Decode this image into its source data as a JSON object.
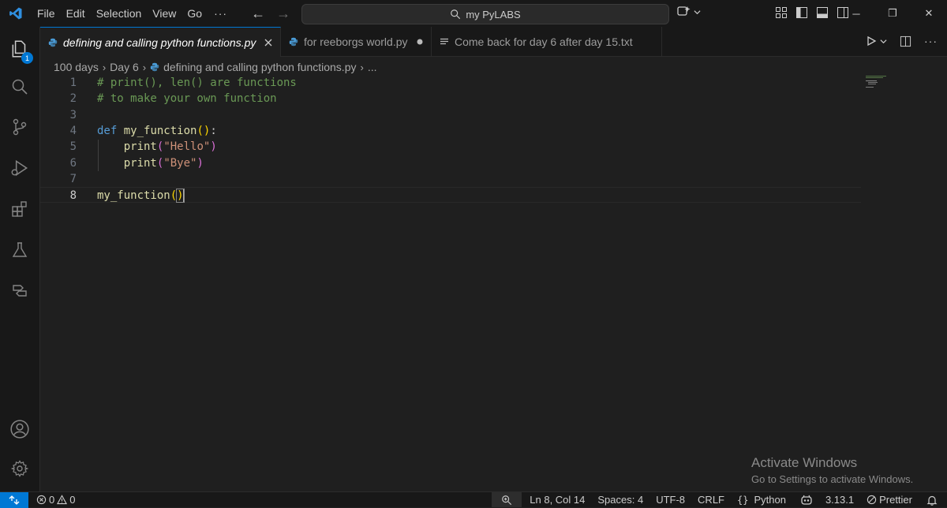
{
  "titlebar": {
    "menus": [
      "File",
      "Edit",
      "Selection",
      "View",
      "Go"
    ],
    "more": "···",
    "search_text": "my PyLABS"
  },
  "activity": {
    "icons": [
      "explorer-icon",
      "search-icon",
      "source-control-icon",
      "run-debug-icon",
      "extensions-icon",
      "testing-icon",
      "remote-explorer-icon",
      "account-icon",
      "manage-gear-icon"
    ],
    "explorer_badge": "1"
  },
  "tabs": [
    {
      "label": "defining and calling python functions.py",
      "icon": "python-icon",
      "active": true,
      "state": "close"
    },
    {
      "label": "for reeborgs world.py",
      "icon": "python-icon",
      "active": false,
      "state": "dirty"
    },
    {
      "label": "Come back for day 6 after day 15.txt",
      "icon": "text-file-icon",
      "active": false,
      "state": "none"
    }
  ],
  "breadcrumb": {
    "items": [
      "100 days",
      "Day 6",
      "defining and calling python functions.py"
    ],
    "ellipsis": "..."
  },
  "editor": {
    "current_line": 8,
    "lines": [
      {
        "n": "1",
        "tokens": [
          [
            "# print(), len() are functions",
            "comment"
          ]
        ]
      },
      {
        "n": "2",
        "tokens": [
          [
            "# to make your own function",
            "comment"
          ]
        ]
      },
      {
        "n": "3",
        "tokens": []
      },
      {
        "n": "4",
        "tokens": [
          [
            "def",
            "kw"
          ],
          [
            " ",
            "text"
          ],
          [
            "my_function",
            "fn"
          ],
          [
            "()",
            "p1"
          ],
          [
            ":",
            "text"
          ]
        ]
      },
      {
        "n": "5",
        "tokens": [
          [
            "    ",
            "text"
          ],
          [
            "print",
            "fn"
          ],
          [
            "(",
            "p2"
          ],
          [
            "\"Hello\"",
            "str"
          ],
          [
            ")",
            "p2"
          ]
        ]
      },
      {
        "n": "6",
        "tokens": [
          [
            "    ",
            "text"
          ],
          [
            "print",
            "fn"
          ],
          [
            "(",
            "p2"
          ],
          [
            "\"Bye\"",
            "str"
          ],
          [
            ")",
            "p2"
          ]
        ]
      },
      {
        "n": "7",
        "tokens": []
      },
      {
        "n": "8",
        "tokens": [
          [
            "my_function",
            "fn"
          ],
          [
            "(",
            "p1"
          ],
          [
            ")",
            "p1-cursor"
          ]
        ]
      }
    ]
  },
  "watermark": {
    "title": "Activate Windows",
    "subtitle": "Go to Settings to activate Windows."
  },
  "statusbar": {
    "errors": "0",
    "warnings": "0",
    "position": "Ln 8, Col 14",
    "spaces": "Spaces: 4",
    "encoding": "UTF-8",
    "eol": "CRLF",
    "language": "Python",
    "python_version": "3.13.1",
    "formatter": "Prettier"
  },
  "colors": {
    "accent": "#0078d4",
    "comment": "#6a9955",
    "keyword": "#569cd6",
    "function": "#dcdcaa",
    "string": "#ce9178",
    "bracket1": "#ffd700",
    "bracket2": "#da70d6"
  }
}
